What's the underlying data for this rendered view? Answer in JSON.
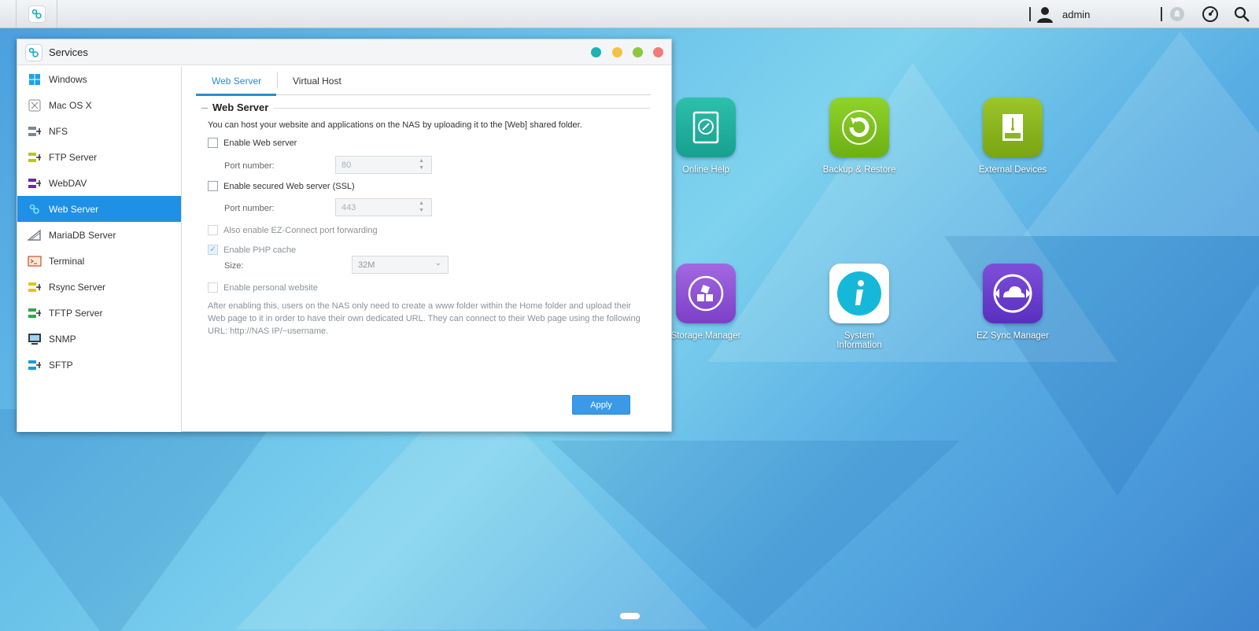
{
  "topbar": {
    "user": "admin"
  },
  "window": {
    "title": "Services",
    "sidebar": [
      {
        "label": "Windows",
        "icon": "windows-icon"
      },
      {
        "label": "Mac OS X",
        "icon": "macos-icon"
      },
      {
        "label": "NFS",
        "icon": "nfs-icon"
      },
      {
        "label": "FTP Server",
        "icon": "ftp-icon"
      },
      {
        "label": "WebDAV",
        "icon": "webdav-icon"
      },
      {
        "label": "Web Server",
        "icon": "web-server-icon"
      },
      {
        "label": "MariaDB Server",
        "icon": "mariadb-icon"
      },
      {
        "label": "Terminal",
        "icon": "terminal-icon"
      },
      {
        "label": "Rsync Server",
        "icon": "rsync-icon"
      },
      {
        "label": "TFTP Server",
        "icon": "tftp-icon"
      },
      {
        "label": "SNMP",
        "icon": "snmp-icon"
      },
      {
        "label": "SFTP",
        "icon": "sftp-icon"
      }
    ],
    "active_item": "Web Server",
    "tabs": [
      {
        "label": "Web Server"
      },
      {
        "label": "Virtual Host"
      }
    ],
    "content": {
      "section_title": "Web Server",
      "description": "You can host your website and applications on the NAS by uploading it to the [Web] shared folder.",
      "enable_web": "Enable Web server",
      "port_label": "Port number:",
      "port_http": "80",
      "enable_ssl": "Enable secured Web server (SSL)",
      "port_https": "443",
      "ez_connect": "Also enable EZ-Connect port forwarding",
      "php_cache": "Enable PHP cache",
      "size_label": "Size:",
      "size_value": "32M",
      "personal_site": "Enable personal website",
      "note": "After enabling this, users on the NAS only need to create a www folder within the Home folder and upload their Web page to it in order to have their own dedicated URL. They can connect to their Web page using the following URL: http://NAS IP/~username.",
      "apply": "Apply"
    }
  },
  "desktop": {
    "icons": [
      {
        "label": "Online Help",
        "color": "#1fae9c"
      },
      {
        "label": "Backup & Restore",
        "color": "#7cc21c"
      },
      {
        "label": "External Devices",
        "color": "#8cb41c"
      },
      {
        "label": "Storage Manager",
        "color": "#8e4fd1"
      },
      {
        "label": "System Information",
        "color": "#12b9d8"
      },
      {
        "label": "EZ Sync Manager",
        "color": "#6b3fcd"
      }
    ]
  },
  "colors": {
    "accent": "#1e90e6",
    "apply": "#3a9ae8"
  }
}
